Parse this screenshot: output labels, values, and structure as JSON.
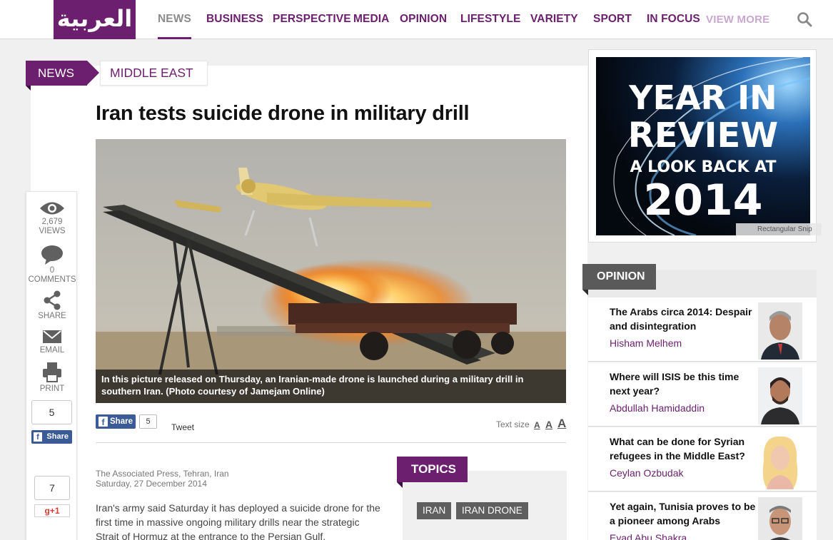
{
  "nav": {
    "logo": "العربية",
    "items": [
      "NEWS",
      "BUSINESS",
      "PERSPECTIVE",
      "MEDIA",
      "OPINION",
      "LIFESTYLE",
      "VARIETY",
      "SPORT",
      "IN FOCUS"
    ],
    "view_more": "VIEW MORE"
  },
  "breadcrumb": {
    "section": "NEWS",
    "subsection": "MIDDLE EAST"
  },
  "article": {
    "headline": "Iran tests suicide drone in military drill",
    "caption": "In this picture released on Thursday, an Iranian-made drone is launched during a military drill in southern Iran. (Photo courtesy of Jamejam Online)",
    "byline_source": "The Associated Press, Tehran, Iran",
    "byline_date": "Saturday, 27 December 2014",
    "body": "Iran's army said Saturday it has deployed a suicide drone for the first time in massive ongoing military drills near the strategic Strait of Hormuz at the entrance to the Persian Gulf."
  },
  "share_bar": {
    "fb_label": "Share",
    "fb_count": "5",
    "tweet_label": "Tweet",
    "text_size_label": "Text size",
    "text_size_options": [
      "A",
      "A",
      "A"
    ]
  },
  "stats": {
    "views_count": "2,679",
    "views_label": "VIEWS",
    "comments_count": "0",
    "comments_label": "COMMENTS",
    "share_label": "SHARE",
    "email_label": "EMAIL",
    "print_label": "PRINT",
    "fb_count": "5",
    "fb_label": "Share",
    "gplus_count": "7",
    "gplus_label": "g+1"
  },
  "topics": {
    "label": "TOPICS",
    "tags": [
      "IRAN",
      "IRAN DRONE"
    ]
  },
  "ad": {
    "line1": "YEAR IN",
    "line2": "REVIEW",
    "line3": "A LOOK BACK AT",
    "line4": "2014",
    "overlay": "Rectangular Snip"
  },
  "opinion": {
    "label": "OPINION",
    "items": [
      {
        "title": "The Arabs circa 2014: Despair and disintegration",
        "author": "Hisham Melhem"
      },
      {
        "title": "Where will ISIS be this time next year?",
        "author": "Abdullah Hamidaddin"
      },
      {
        "title": "What can be done for Syrian refugees in the Middle East?",
        "author": "Ceylan Ozbudak"
      },
      {
        "title": "Yet again, Tunisia proves to be a pioneer among Arabs",
        "author": "Eyad Abu Shakra"
      }
    ]
  },
  "colors": {
    "brand_purple": "#6b1f6e",
    "facebook_blue": "#3b5a98",
    "opinion_gray": "#5a5a5a"
  }
}
